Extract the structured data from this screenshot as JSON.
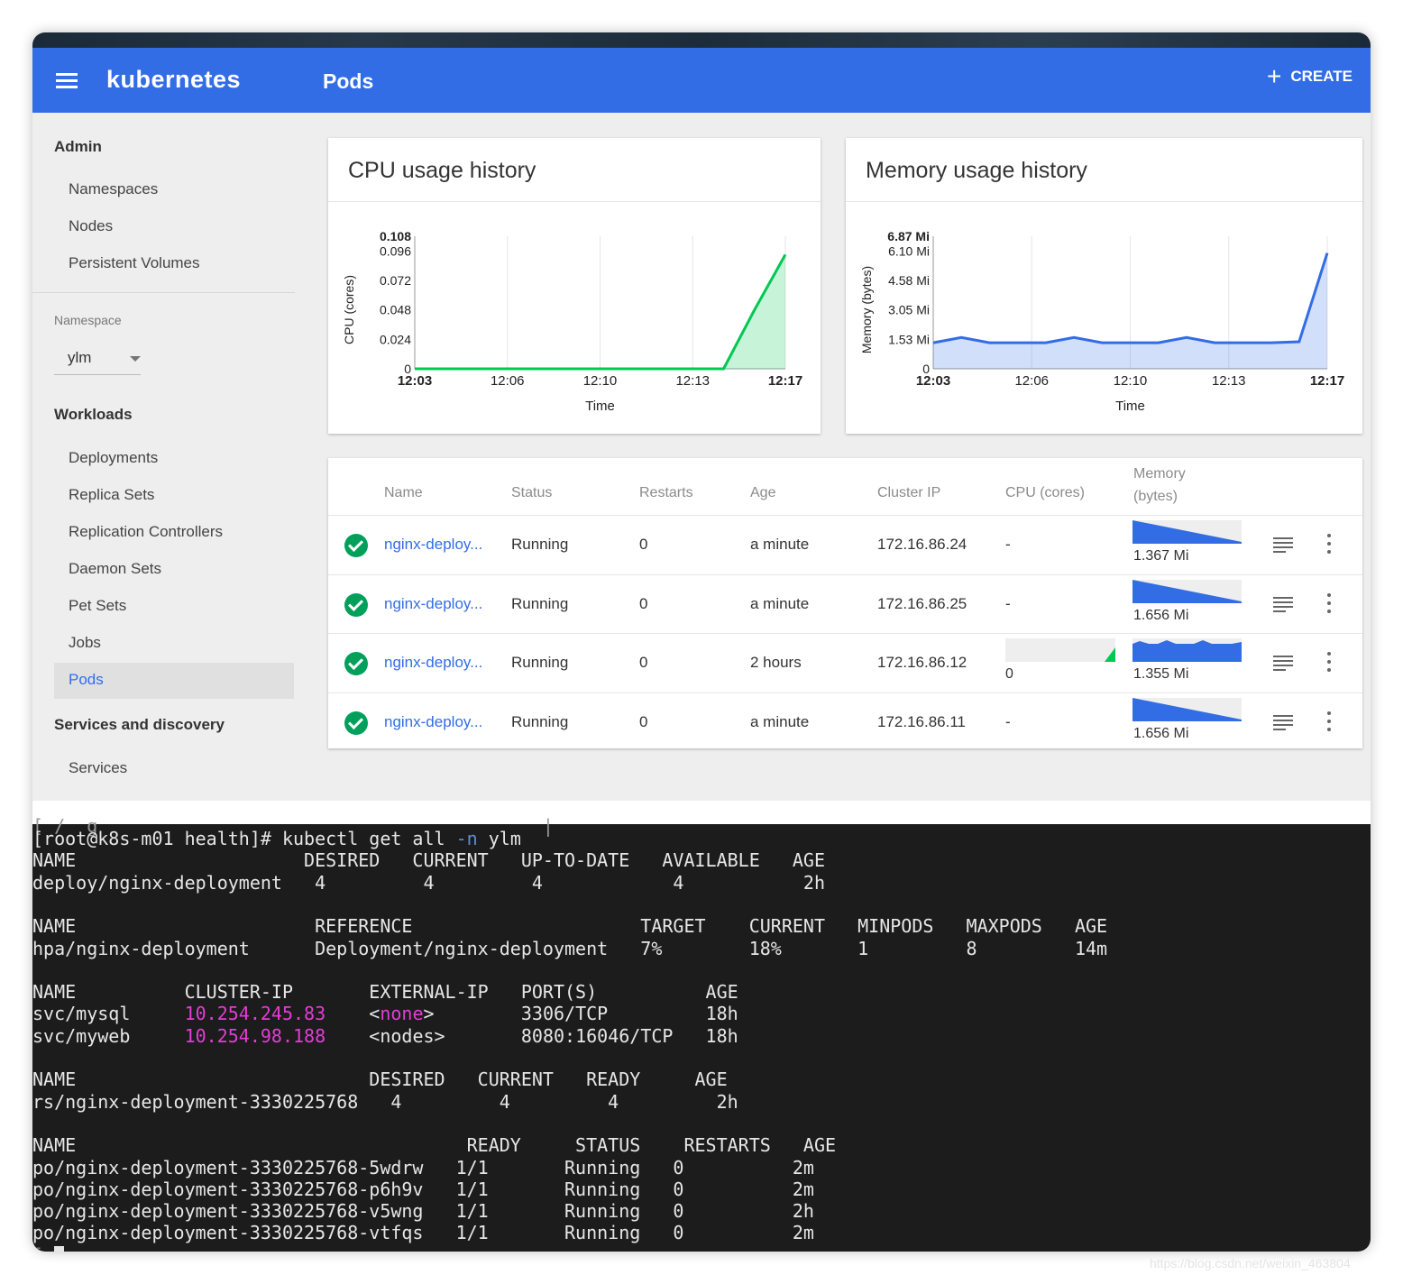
{
  "header": {
    "brand": "kubernetes",
    "title": "Pods",
    "create_label": "CREATE",
    "accent": "#326de6"
  },
  "sidebar": {
    "admin_label": "Admin",
    "admin_items": [
      "Namespaces",
      "Nodes",
      "Persistent Volumes"
    ],
    "namespace_label": "Namespace",
    "namespace_value": "ylm",
    "workloads_label": "Workloads",
    "workload_items": [
      "Deployments",
      "Replica Sets",
      "Replication Controllers",
      "Daemon Sets",
      "Pet Sets",
      "Jobs",
      "Pods"
    ],
    "active_item": "Pods",
    "services_label": "Services and discovery",
    "services_items": [
      "Services"
    ]
  },
  "charts": {
    "cpu_title": "CPU usage history",
    "mem_title": "Memory usage history"
  },
  "chart_data": [
    {
      "type": "area",
      "title": "CPU usage history",
      "xlabel": "Time",
      "ylabel": "CPU (cores)",
      "x_ticks": [
        "12:03",
        "12:06",
        "12:10",
        "12:13",
        "12:17"
      ],
      "y_ticks": [
        "0",
        "0.024",
        "0.048",
        "0.072",
        "0.096",
        "0.108"
      ],
      "ylim": [
        0,
        0.108
      ],
      "color": "#00c853",
      "series": [
        {
          "values": [
            0,
            0,
            0,
            0,
            0,
            0,
            0,
            0,
            0,
            0,
            0,
            0.048,
            0.093
          ]
        }
      ]
    },
    {
      "type": "area",
      "title": "Memory usage history",
      "xlabel": "Time",
      "ylabel": "Memory (bytes)",
      "x_ticks": [
        "12:03",
        "12:06",
        "12:10",
        "12:13",
        "12:17"
      ],
      "y_ticks": [
        "0",
        "1.53 Mi",
        "3.05 Mi",
        "4.58 Mi",
        "6.10 Mi",
        "6.87 Mi"
      ],
      "ylim": [
        0,
        6.87
      ],
      "color": "#326de6",
      "series": [
        {
          "values": [
            1.35,
            1.62,
            1.35,
            1.35,
            1.35,
            1.62,
            1.35,
            1.35,
            1.35,
            1.62,
            1.35,
            1.35,
            1.35,
            1.4,
            6.0
          ]
        }
      ]
    }
  ],
  "table": {
    "headers": [
      "Name",
      "Status",
      "Restarts",
      "Age",
      "Cluster IP",
      "CPU (cores)",
      "Memory",
      "(bytes)"
    ],
    "rows": [
      {
        "name": "nginx-deploy...",
        "status": "Running",
        "restarts": "0",
        "age": "a minute",
        "ip": "172.16.86.24",
        "cpu": "-",
        "mem": "1.367 Mi",
        "mem_shape": "ramp"
      },
      {
        "name": "nginx-deploy...",
        "status": "Running",
        "restarts": "0",
        "age": "a minute",
        "ip": "172.16.86.25",
        "cpu": "-",
        "mem": "1.656 Mi",
        "mem_shape": "ramp"
      },
      {
        "name": "nginx-deploy...",
        "status": "Running",
        "restarts": "0",
        "age": "2 hours",
        "ip": "172.16.86.12",
        "cpu": "0",
        "mem": "1.355 Mi",
        "mem_shape": "flat"
      },
      {
        "name": "nginx-deploy...",
        "status": "Running",
        "restarts": "0",
        "age": "a minute",
        "ip": "172.16.86.11",
        "cpu": "-",
        "mem": "1.656 Mi",
        "mem_shape": "ramp"
      }
    ]
  },
  "terminal": {
    "lines": [
      {
        "t": "[root@k8s-m01 health]# kubectl get all ",
        "flag": "-n",
        "rest": " ylm"
      },
      {
        "t": "NAME                     DESIRED   CURRENT   UP-TO-DATE   AVAILABLE   AGE"
      },
      {
        "t": "deploy/nginx-deployment   4         4         4            4           2h"
      },
      {
        "t": ""
      },
      {
        "t": "NAME                      REFERENCE                     TARGET    CURRENT   MINPODS   MAXPODS   AGE"
      },
      {
        "t": "hpa/nginx-deployment      Deployment/nginx-deployment   7%        18%       1         8         14m"
      },
      {
        "t": ""
      },
      {
        "t": "NAME          CLUSTER-IP       EXTERNAL-IP   PORT(S)          AGE"
      },
      {
        "t": "svc/mysql     ",
        "ip": "10.254.245.83",
        "mid": "    <",
        "none": "none",
        "rest": ">        3306/TCP         18h"
      },
      {
        "t": "svc/myweb     ",
        "ip": "10.254.98.188",
        "rest": "    <nodes>       8080:16046/TCP   18h"
      },
      {
        "t": ""
      },
      {
        "t": "NAME                           DESIRED   CURRENT   READY     AGE"
      },
      {
        "t": "rs/nginx-deployment-3330225768   4         4         4         2h"
      },
      {
        "t": ""
      },
      {
        "t": "NAME                                    READY     STATUS    RESTARTS   AGE"
      },
      {
        "t": "po/nginx-deployment-3330225768-5wdrw   1/1       Running   0          2m"
      },
      {
        "t": "po/nginx-deployment-3330225768-p6h9v   1/1       Running   0          2m"
      },
      {
        "t": "po/nginx-deployment-3330225768-v5wng   1/1       Running   0          2h"
      },
      {
        "t": "po/nginx-deployment-3330225768-vtfqs   1/1       Running   0          2m"
      }
    ]
  },
  "watermark": "https://blog.csdn.net/weixin_463804"
}
